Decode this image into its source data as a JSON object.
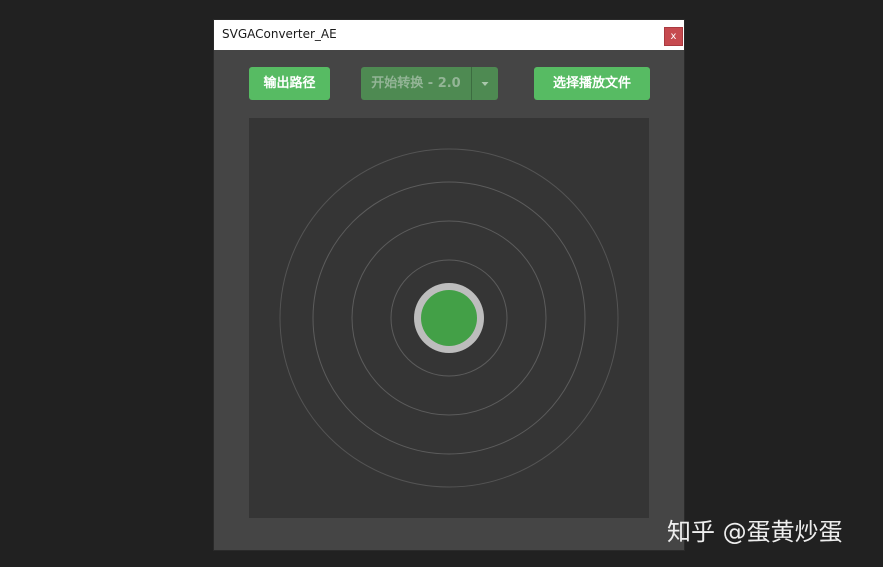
{
  "window": {
    "title": "SVGAConverter_AE",
    "close_label": "x"
  },
  "toolbar": {
    "output_path_label": "输出路径",
    "start_convert_label": "开始转换 - 2.0",
    "select_play_file_label": "选择播放文件"
  },
  "watermark": {
    "text": "知乎 @蛋黄炒蛋"
  },
  "colors": {
    "accent_green": "#57bb63",
    "disabled_green": "#4e8a52",
    "record_dot": "#43a047",
    "record_ring": "#bdbdbd"
  },
  "icons": {
    "dropdown": "caret-down-icon",
    "record": "record-dot-icon"
  }
}
